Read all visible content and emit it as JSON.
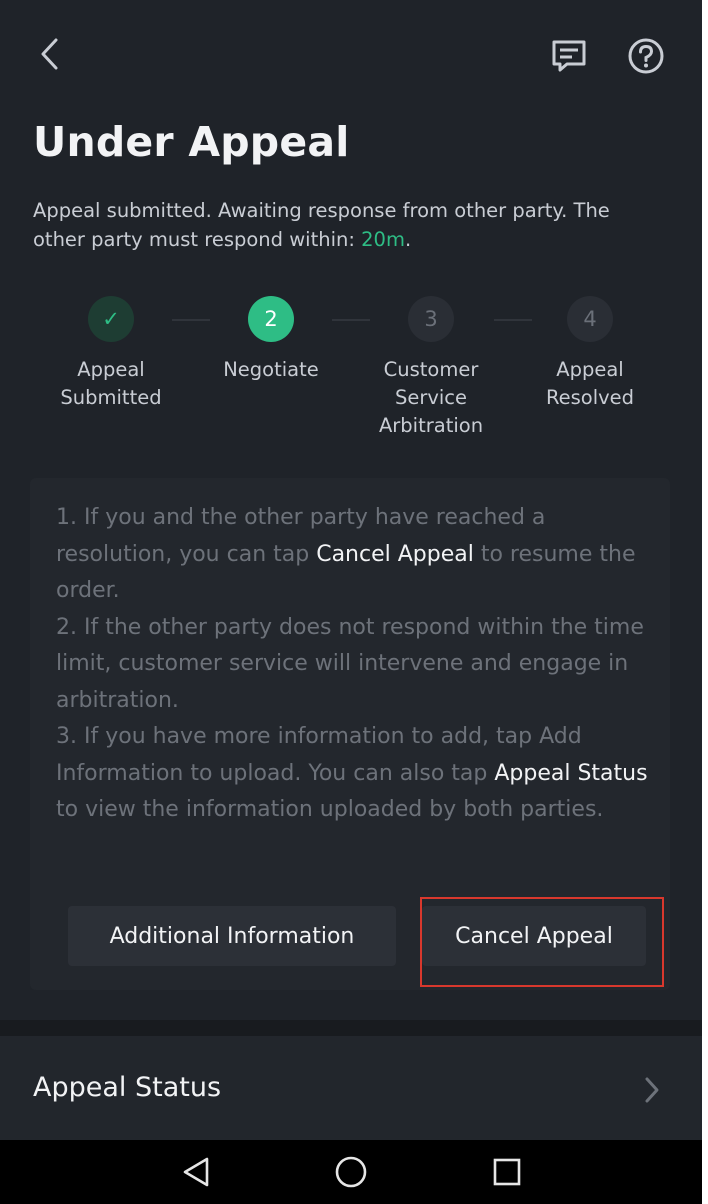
{
  "header": {
    "title": "Under Appeal"
  },
  "description": {
    "text": "Appeal submitted. Awaiting response from other party. The other party must respond within: ",
    "timer": "20m",
    "suffix": "."
  },
  "steps": [
    {
      "marker": "✓",
      "label": "Appeal Submitted",
      "state": "done"
    },
    {
      "marker": "2",
      "label": "Negotiate",
      "state": "active"
    },
    {
      "marker": "3",
      "label": "Customer Service Arbitration",
      "state": "todo"
    },
    {
      "marker": "4",
      "label": "Appeal Resolved",
      "state": "todo"
    }
  ],
  "info": {
    "p1_a": "1. If you and the other party have reached a resolution, you can tap ",
    "p1_hl": "Cancel Appeal",
    "p1_b": " to resume the order.",
    "p2": "2. If the other party does not respond within the time limit, customer service will intervene and engage in arbitration.",
    "p3_a": "3. If you have more information to add, tap Add Information to upload. You can also tap ",
    "p3_hl": "Appeal Status",
    "p3_b": " to view the information uploaded by both parties."
  },
  "buttons": {
    "additional_info": "Additional Information",
    "cancel_appeal": "Cancel Appeal"
  },
  "status_row": {
    "label": "Appeal Status"
  },
  "icons": {
    "back": "chevron-left-icon",
    "chat": "message-icon",
    "help": "question-circle-icon",
    "chevron": "chevron-right-icon"
  },
  "colors": {
    "accent": "#2ebd85",
    "background": "#1f2329",
    "highlight_border": "#d9382d"
  }
}
